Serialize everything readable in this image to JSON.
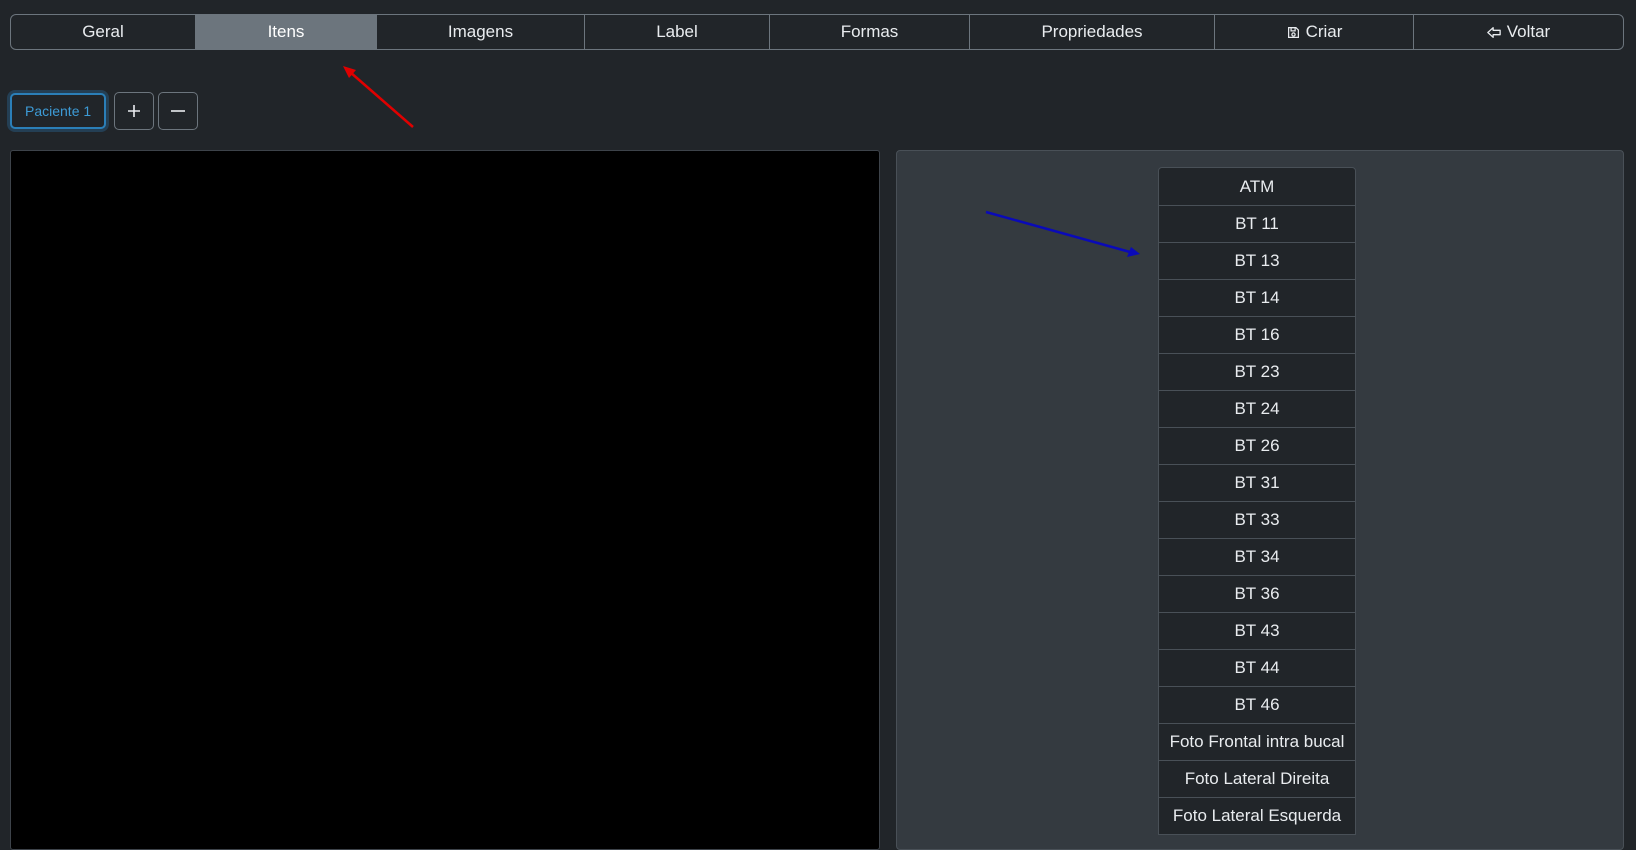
{
  "tabs": [
    {
      "label": "Geral",
      "active": false
    },
    {
      "label": "Itens",
      "active": true
    },
    {
      "label": "Imagens",
      "active": false
    },
    {
      "label": "Label",
      "active": false
    },
    {
      "label": "Formas",
      "active": false
    },
    {
      "label": "Propriedades",
      "active": false
    },
    {
      "label": "Criar",
      "icon": "floppy-disk-icon",
      "active": false
    },
    {
      "label": "Voltar",
      "icon": "arrow-left-icon",
      "active": false
    }
  ],
  "patients": {
    "current_label": "Paciente 1",
    "add_icon": "plus-icon",
    "remove_icon": "minus-icon"
  },
  "items": [
    "ATM",
    "BT 11",
    "BT 13",
    "BT 14",
    "BT 16",
    "BT 23",
    "BT 24",
    "BT 26",
    "BT 31",
    "BT 33",
    "BT 34",
    "BT 36",
    "BT 43",
    "BT 44",
    "BT 46",
    "Foto Frontal intra bucal",
    "Foto Lateral Direita",
    "Foto Lateral Esquerda"
  ],
  "annotations": {
    "red_arrow_color": "#e00000",
    "blue_arrow_color": "#0a0ab8"
  },
  "colors": {
    "background": "#212529",
    "active_tab": "#6c757d",
    "panel": "#343a40",
    "canvas": "#000000",
    "patient_accent": "#3d9bd6"
  }
}
